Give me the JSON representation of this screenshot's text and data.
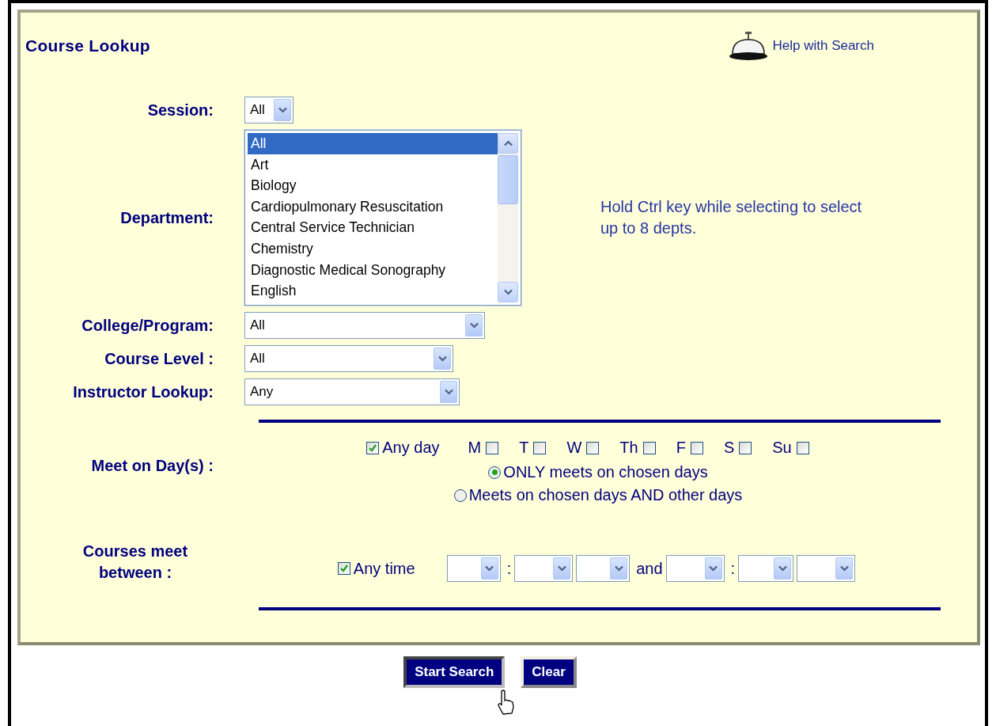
{
  "title": "Course Lookup",
  "help_link": "Help with Search",
  "session": {
    "label": "Session:",
    "value": "All"
  },
  "department": {
    "label": "Department:",
    "hint": "Hold Ctrl key while selecting to select up to 8 depts.",
    "options": [
      {
        "text": "All",
        "selected": true
      },
      {
        "text": "Art",
        "selected": false
      },
      {
        "text": "Biology",
        "selected": false
      },
      {
        "text": "Cardiopulmonary Resuscitation",
        "selected": false
      },
      {
        "text": "Central Service Technician",
        "selected": false
      },
      {
        "text": "Chemistry",
        "selected": false
      },
      {
        "text": "Diagnostic Medical Sonography",
        "selected": false
      },
      {
        "text": "English",
        "selected": false
      }
    ]
  },
  "dropdowns": [
    {
      "label": "College/Program:",
      "value": "All"
    },
    {
      "label": "Course Level :",
      "value": "All"
    },
    {
      "label": "Instructor Lookup:",
      "value": "Any"
    }
  ],
  "meet_days": {
    "label": "Meet on Day(s) :",
    "any": {
      "label": "Any day",
      "checked": true
    },
    "days": [
      {
        "label": "M",
        "checked": false
      },
      {
        "label": "T",
        "checked": false
      },
      {
        "label": "W",
        "checked": false
      },
      {
        "label": "Th",
        "checked": false
      },
      {
        "label": "F",
        "checked": false
      },
      {
        "label": "S",
        "checked": false
      },
      {
        "label": "Su",
        "checked": false
      }
    ],
    "options": [
      {
        "label": "ONLY meets on chosen days",
        "selected": true
      },
      {
        "label": "Meets on chosen days AND other days",
        "selected": false
      }
    ]
  },
  "meet_time": {
    "label": "Courses meet between :",
    "any": {
      "label": "Any time",
      "checked": true
    },
    "fields": [
      {
        "kind": "select"
      },
      {
        "kind": "separator",
        "text": ":"
      },
      {
        "kind": "select"
      },
      {
        "kind": "select"
      },
      {
        "kind": "separator",
        "text": "and"
      },
      {
        "kind": "select"
      },
      {
        "kind": "separator",
        "text": ":"
      },
      {
        "kind": "select"
      },
      {
        "kind": "select"
      }
    ]
  },
  "buttons": [
    {
      "label": "Start Search",
      "focused": true
    },
    {
      "label": "Clear",
      "focused": false
    }
  ]
}
